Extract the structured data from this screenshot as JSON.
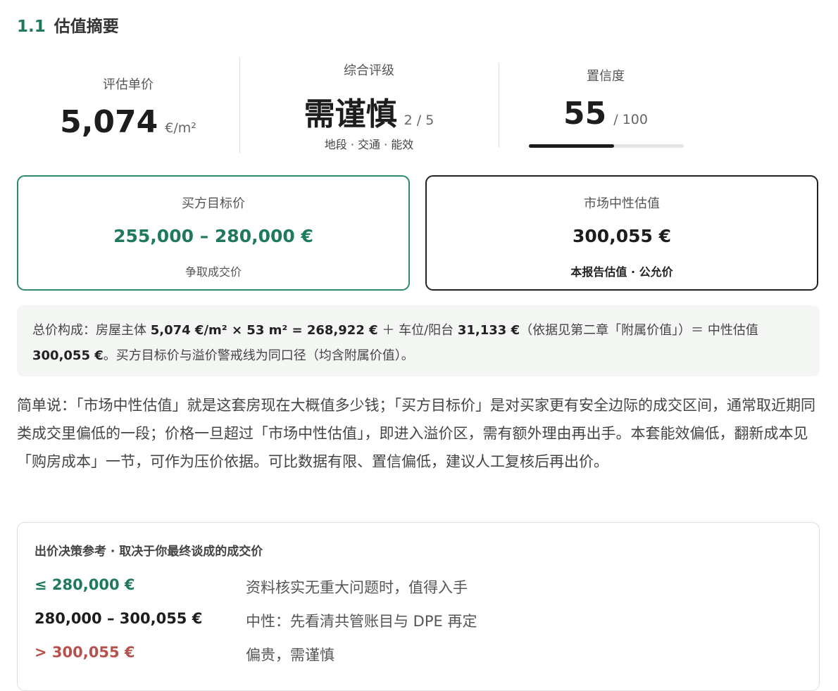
{
  "section": {
    "number": "1.1",
    "title": "估值摘要"
  },
  "metrics": {
    "unit_price": {
      "label": "评估单价",
      "value": "5,074",
      "unit": "€/m²"
    },
    "rating": {
      "label": "综合评级",
      "value": "需谨慎",
      "scale": "2 / 5",
      "factors": "地段 · 交通 · 能效"
    },
    "confidence": {
      "label": "置信度",
      "value": "55",
      "scale": "/ 100",
      "fraction": 0.55
    }
  },
  "cards": {
    "buyer_target": {
      "title": "买方目标价",
      "value": "255,000 – 280,000 €",
      "note": "争取成交价"
    },
    "market_neutral": {
      "title": "市场中性估值",
      "value": "300,055 €",
      "note": "本报告估值 · 公允价"
    }
  },
  "composition": {
    "p1": "总价构成：房屋主体 ",
    "b1": "5,074 €/m² × 53 m² = 268,922 €",
    "p2": " ＋ 车位/阳台 ",
    "b2": "31,133 €",
    "p3": "（依据见第二章「附属价值」）＝ 中性估值 ",
    "b3": "300,055 €",
    "p4": "。买方目标价与溢价警戒线为同口径（均含附属价值）。"
  },
  "summary": "简单说：「市场中性估值」就是这套房现在大概值多少钱；「买方目标价」是对买家更有安全边际的成交区间，通常取近期同类成交里偏低的一段；价格一旦超过「市场中性估值」，即进入溢价区，需有额外理由再出手。本套能效偏低，翻新成本见「购房成本」一节，可作为压价依据。可比数据有限、置信偏低，建议人工复核后再出价。",
  "decision": {
    "title": "出价决策参考 · 取决于你最终谈成的成交价",
    "rows": [
      {
        "price": "≤ 280,000 €",
        "desc": "资料核实无重大问题时，值得入手"
      },
      {
        "price": "280,000 – 300,055 €",
        "desc": "中性：先看清共管账目与 DPE 再定"
      },
      {
        "price": "> 300,055 €",
        "desc": "偏贵，需谨慎"
      }
    ]
  },
  "colors": {
    "accent_green": "#1f7a5c",
    "warning_red": "#b5524d",
    "dark": "#1d1d1d"
  }
}
